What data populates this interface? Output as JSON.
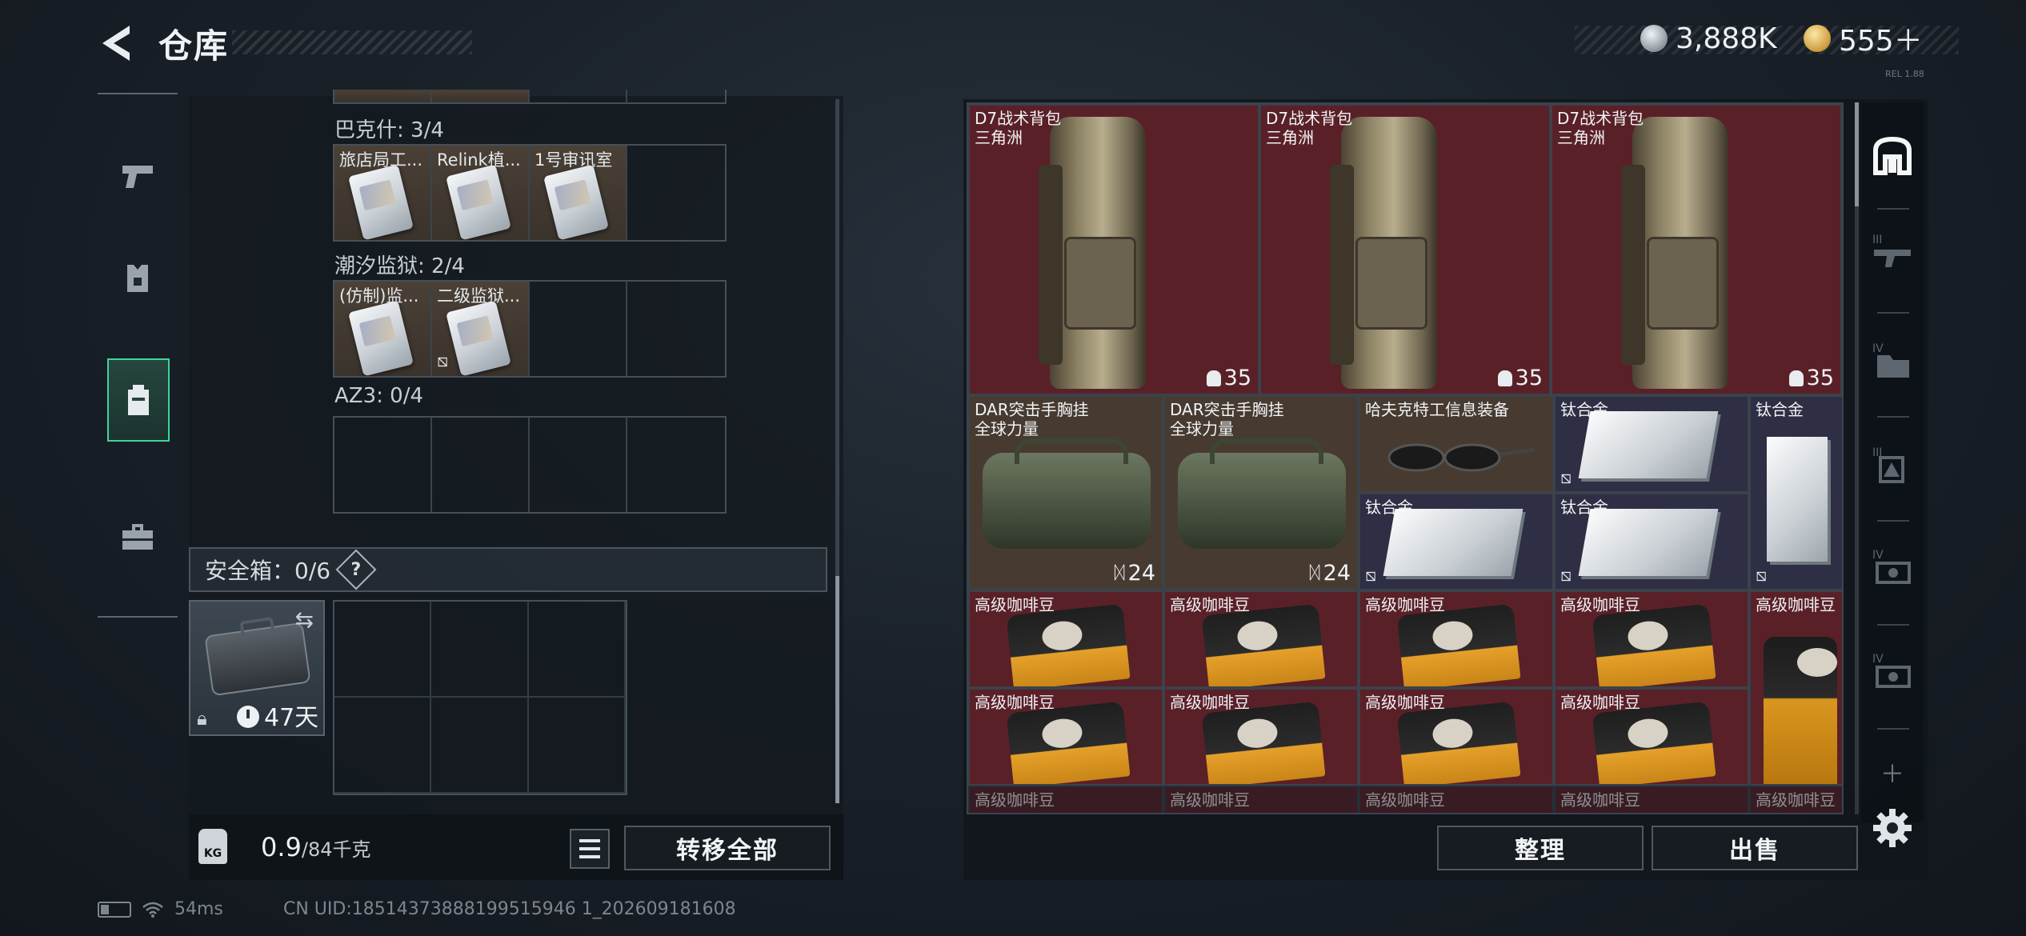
{
  "header": {
    "title": "仓库",
    "currency_silver": "3,888K",
    "currency_gold": "555＋",
    "build_tag": "REL 1.88"
  },
  "left_nav": [
    {
      "icon": "pistol-icon",
      "active": false
    },
    {
      "icon": "armor-icon",
      "active": false
    },
    {
      "icon": "backpack-icon",
      "active": true
    },
    {
      "icon": "toolbox-icon",
      "active": false
    }
  ],
  "keys": {
    "groups": [
      {
        "label": "巴克什: 3/4",
        "items": [
          "旅店局工...",
          "Relink植...",
          "1号审讯室",
          ""
        ]
      },
      {
        "label": "潮汐监狱: 2/4",
        "items": [
          "(仿制)监...",
          "二级监狱...",
          "",
          ""
        ]
      },
      {
        "label": "AZ3: 0/4",
        "items": [
          "",
          "",
          "",
          ""
        ]
      }
    ]
  },
  "safe_box": {
    "label": "安全箱：0/6",
    "help": "?",
    "duration": "47天"
  },
  "bottom_left": {
    "weight_current": "0.9",
    "weight_max": "/84千克",
    "kg_label": "KG",
    "transfer_all": "转移全部"
  },
  "inventory": {
    "backpacks": [
      {
        "name": "D7战术背包\n三角洲",
        "count": "35"
      },
      {
        "name": "D7战术背包\n三角洲",
        "count": "35"
      },
      {
        "name": "D7战术背包\n三角洲",
        "count": "35"
      }
    ],
    "vests": [
      {
        "name": "DAR突击手胸挂\n全球力量",
        "count": "24"
      },
      {
        "name": "DAR突击手胸挂\n全球力量",
        "count": "24"
      }
    ],
    "glasses": "哈夫克特工信息装备",
    "titanium": "钛合金",
    "coffee": "高级咖啡豆"
  },
  "bottom_right": {
    "organize": "整理",
    "sell": "出售"
  },
  "status": {
    "ping": "54ms",
    "uid": "CN UID:18514373888199515946 1_202609181608"
  }
}
